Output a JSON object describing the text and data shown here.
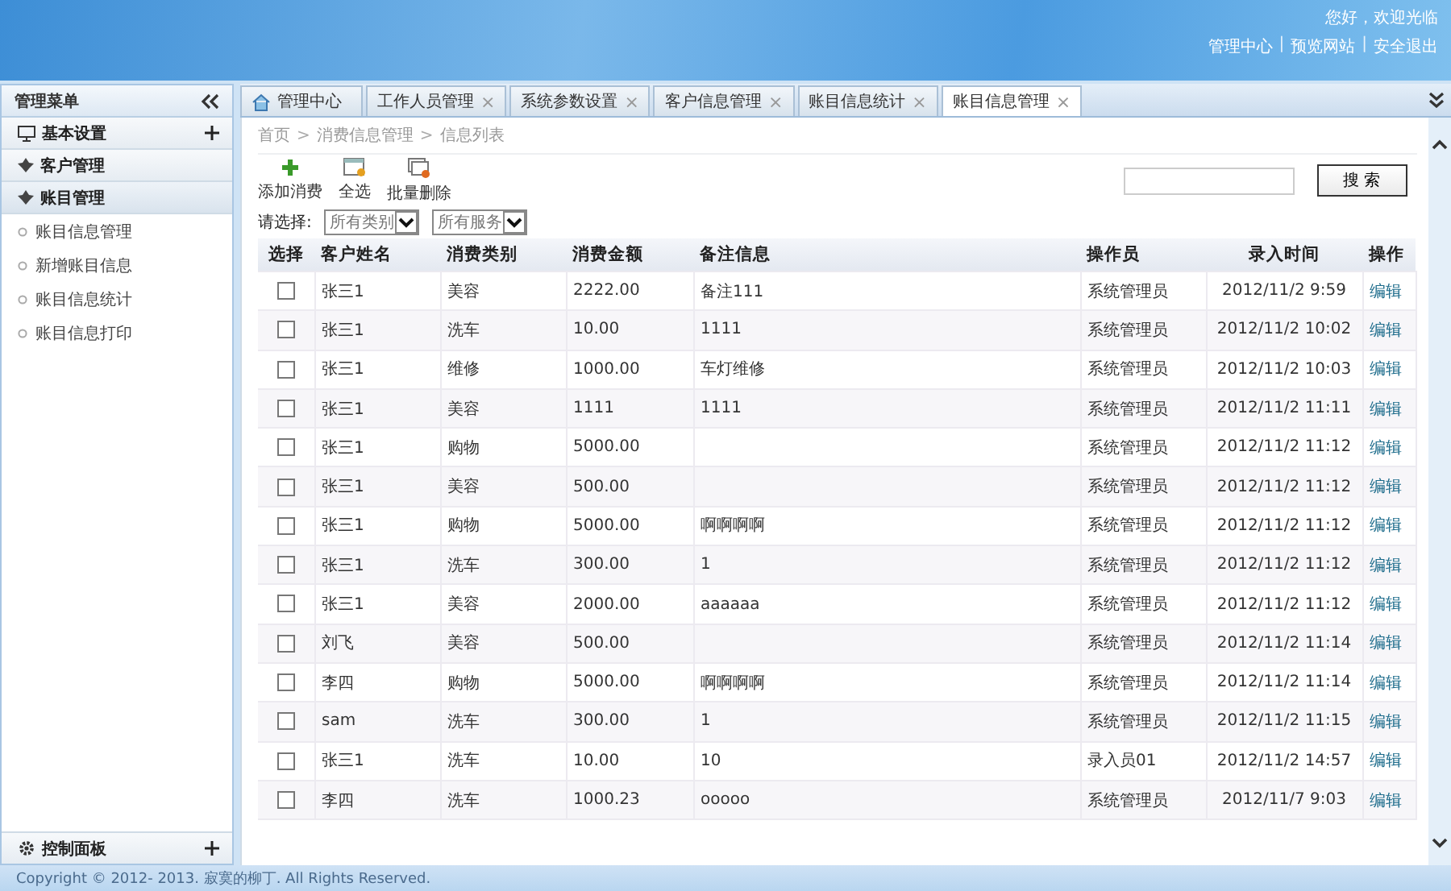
{
  "header": {
    "greeting": "您好，欢迎光临",
    "links": [
      "管理中心",
      "预览网站",
      "安全退出"
    ],
    "separator": "|"
  },
  "sidebar": {
    "title": "管理菜单",
    "sections": [
      {
        "label": "基本设置",
        "kind": "settings",
        "expanded": false
      },
      {
        "label": "客户管理",
        "kind": "leaf",
        "expanded": false
      },
      {
        "label": "账目管理",
        "kind": "leaf",
        "expanded": true,
        "children": [
          {
            "label": "账目信息管理"
          },
          {
            "label": "新增账目信息"
          },
          {
            "label": "账目信息统计"
          },
          {
            "label": "账目信息打印"
          }
        ]
      }
    ],
    "bottom": {
      "label": "控制面板"
    }
  },
  "tabs": [
    {
      "label": "管理中心",
      "kind": "home",
      "selected": false
    },
    {
      "label": "工作人员管理",
      "kind": "closable",
      "selected": false
    },
    {
      "label": "系统参数设置",
      "kind": "closable",
      "selected": false
    },
    {
      "label": "客户信息管理",
      "kind": "closable",
      "selected": false
    },
    {
      "label": "账目信息统计",
      "kind": "closable",
      "selected": false
    },
    {
      "label": "账目信息管理",
      "kind": "closable",
      "selected": true
    }
  ],
  "close_glyph": "×",
  "breadcrumb": [
    "首页",
    "消费信息管理",
    "信息列表"
  ],
  "breadcrumb_sep": ">",
  "toolbar": [
    {
      "label": "添加消费",
      "kind": "add"
    },
    {
      "label": "全选",
      "kind": "select"
    },
    {
      "label": "批量删除",
      "kind": "delete"
    }
  ],
  "search": {
    "button": "搜 索"
  },
  "filter": {
    "label": "请选择:",
    "selects": [
      "所有类别",
      "所有服务"
    ]
  },
  "table": {
    "columns": [
      "选择",
      "客户姓名",
      "消费类别",
      "消费金额",
      "备注信息",
      "操作员",
      "录入时间",
      "操作"
    ],
    "rows": [
      {
        "checked": false,
        "cells": [
          "",
          "张三1",
          "美容",
          "2222.00",
          "备注111",
          "系统管理员",
          "2012/11/2 9:59",
          "编辑"
        ]
      },
      {
        "checked": false,
        "cells": [
          "",
          "张三1",
          "洗车",
          "10.00",
          "1111",
          "系统管理员",
          "2012/11/2 10:02",
          "编辑"
        ]
      },
      {
        "checked": false,
        "cells": [
          "",
          "张三1",
          "维修",
          "1000.00",
          "车灯维修",
          "系统管理员",
          "2012/11/2 10:03",
          "编辑"
        ]
      },
      {
        "checked": false,
        "cells": [
          "",
          "张三1",
          "美容",
          "1111",
          "1111",
          "系统管理员",
          "2012/11/2 11:11",
          "编辑"
        ]
      },
      {
        "checked": false,
        "cells": [
          "",
          "张三1",
          "购物",
          "5000.00",
          "",
          "系统管理员",
          "2012/11/2 11:12",
          "编辑"
        ]
      },
      {
        "checked": false,
        "cells": [
          "",
          "张三1",
          "美容",
          "500.00",
          "",
          "系统管理员",
          "2012/11/2 11:12",
          "编辑"
        ]
      },
      {
        "checked": false,
        "cells": [
          "",
          "张三1",
          "购物",
          "5000.00",
          "啊啊啊啊",
          "系统管理员",
          "2012/11/2 11:12",
          "编辑"
        ]
      },
      {
        "checked": false,
        "cells": [
          "",
          "张三1",
          "洗车",
          "300.00",
          "1",
          "系统管理员",
          "2012/11/2 11:12",
          "编辑"
        ]
      },
      {
        "checked": false,
        "cells": [
          "",
          "张三1",
          "美容",
          "2000.00",
          "aaaaaa",
          "系统管理员",
          "2012/11/2 11:12",
          "编辑"
        ]
      },
      {
        "checked": false,
        "cells": [
          "",
          "刘飞",
          "美容",
          "500.00",
          "",
          "系统管理员",
          "2012/11/2 11:14",
          "编辑"
        ]
      },
      {
        "checked": false,
        "cells": [
          "",
          "李四",
          "购物",
          "5000.00",
          "啊啊啊啊",
          "系统管理员",
          "2012/11/2 11:14",
          "编辑"
        ]
      },
      {
        "checked": false,
        "cells": [
          "",
          "sam",
          "洗车",
          "300.00",
          "1",
          "系统管理员",
          "2012/11/2 11:15",
          "编辑"
        ]
      },
      {
        "checked": false,
        "cells": [
          "",
          "张三1",
          "洗车",
          "10.00",
          "10",
          "录入员01",
          "2012/11/2 14:57",
          "编辑"
        ]
      },
      {
        "checked": false,
        "cells": [
          "",
          "李四",
          "洗车",
          "1000.23",
          "ooooo",
          "系统管理员",
          "2012/11/7 9:03",
          "编辑"
        ]
      }
    ]
  },
  "footer": "Copyright © 2012- 2013. 寂寞的柳丁. All Rights Reserved."
}
